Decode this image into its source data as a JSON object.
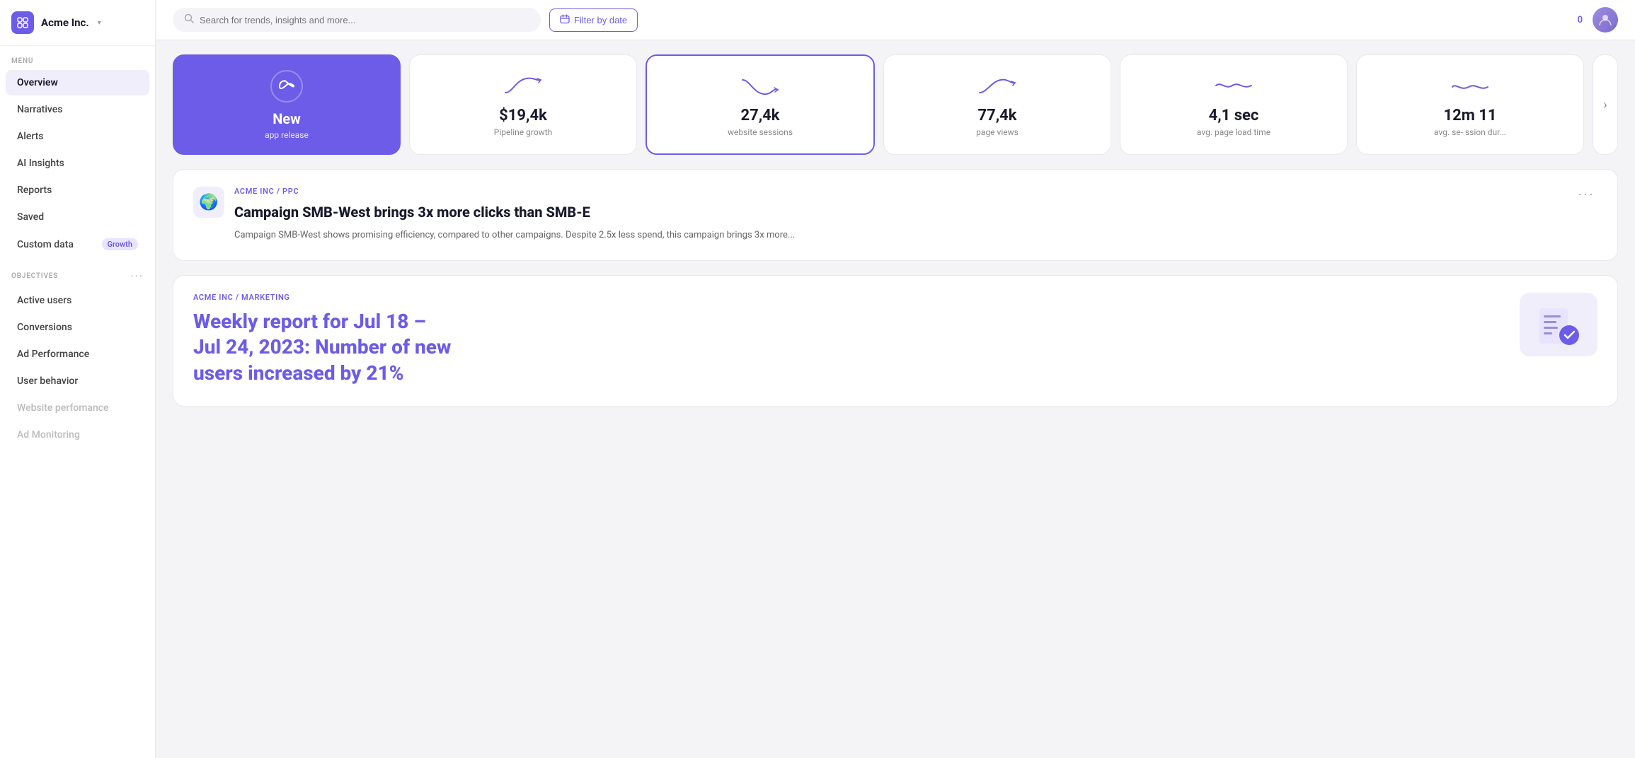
{
  "company": {
    "name": "Acme Inc.",
    "logo_symbol": "◇"
  },
  "topbar": {
    "search_placeholder": "Search for trends, insights and more...",
    "filter_label": "Filter by date",
    "notification_count": "0"
  },
  "sidebar": {
    "menu_label": "MENU",
    "items": [
      {
        "id": "overview",
        "label": "Overview",
        "active": true
      },
      {
        "id": "narratives",
        "label": "Narratives",
        "active": false
      },
      {
        "id": "alerts",
        "label": "Alerts",
        "active": false
      },
      {
        "id": "ai-insights",
        "label": "AI Insights",
        "active": false
      },
      {
        "id": "reports",
        "label": "Reports",
        "active": false
      },
      {
        "id": "saved",
        "label": "Saved",
        "active": false
      },
      {
        "id": "custom-data",
        "label": "Custom data",
        "badge": "Growth",
        "active": false
      }
    ],
    "objectives_label": "OBJECTIVES",
    "objectives": [
      {
        "id": "active-users",
        "label": "Active users"
      },
      {
        "id": "conversions",
        "label": "Conversions"
      },
      {
        "id": "ad-performance",
        "label": "Ad Performance"
      },
      {
        "id": "user-behavior",
        "label": "User behavior"
      },
      {
        "id": "website-performance",
        "label": "Website perfomance",
        "disabled": true
      },
      {
        "id": "ad-monitoring",
        "label": "Ad Monitoring",
        "disabled": true
      }
    ]
  },
  "metrics": [
    {
      "id": "new-app-release",
      "value": "New",
      "label": "app release",
      "featured": true,
      "icon": "infinity"
    },
    {
      "id": "pipeline-growth",
      "value": "$19,4k",
      "label": "Pipeline growth",
      "featured": false
    },
    {
      "id": "website-sessions",
      "value": "27,4k",
      "label": "website sessions",
      "featured": false,
      "selected": true
    },
    {
      "id": "page-views",
      "value": "77,4k",
      "label": "page views",
      "featured": false
    },
    {
      "id": "avg-page-load",
      "value": "4,1 sec",
      "label": "avg. page load time",
      "featured": false
    },
    {
      "id": "avg-session-dur",
      "value": "12m 11",
      "label": "avg. se- ssion dur...",
      "featured": false
    }
  ],
  "cards": [
    {
      "id": "ppc-card",
      "breadcrumb": "ACME INC / PPC",
      "title": "Campaign SMB-West brings  3x more clicks than SMB-E",
      "body": "Campaign SMB-West shows promising efficiency, compared to other campaigns. Despite 2.5x less spend, this campaign brings  3x more...",
      "icon": "🌍"
    },
    {
      "id": "marketing-card",
      "breadcrumb": "ACME INC / MARKETING",
      "title_line1": "Weekly report for Jul 18 –",
      "title_line2": "Jul 24, 2023: Number of new",
      "title_line3": "users increased by 21%"
    }
  ]
}
